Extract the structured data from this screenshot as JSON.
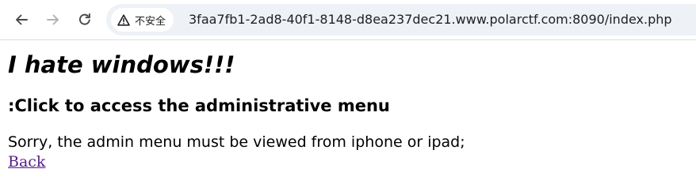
{
  "browser": {
    "security_label": "不安全",
    "url": "3faa7fb1-2ad8-40f1-8148-d8ea237dec21.www.polarctf.com:8090/index.php",
    "icons": {
      "back": "arrow-left-icon",
      "forward": "arrow-right-icon",
      "reload": "reload-icon",
      "security": "warning-triangle-icon"
    }
  },
  "page": {
    "title": "I hate windows!!!",
    "subheading": ":Click to access the administrative menu",
    "message": "Sorry, the admin menu must be viewed from iphone or ipad;",
    "back_link": "Back"
  },
  "colors": {
    "visited_link": "#551a8b",
    "omnibox_bg": "#eef1f5",
    "text": "#000000"
  }
}
